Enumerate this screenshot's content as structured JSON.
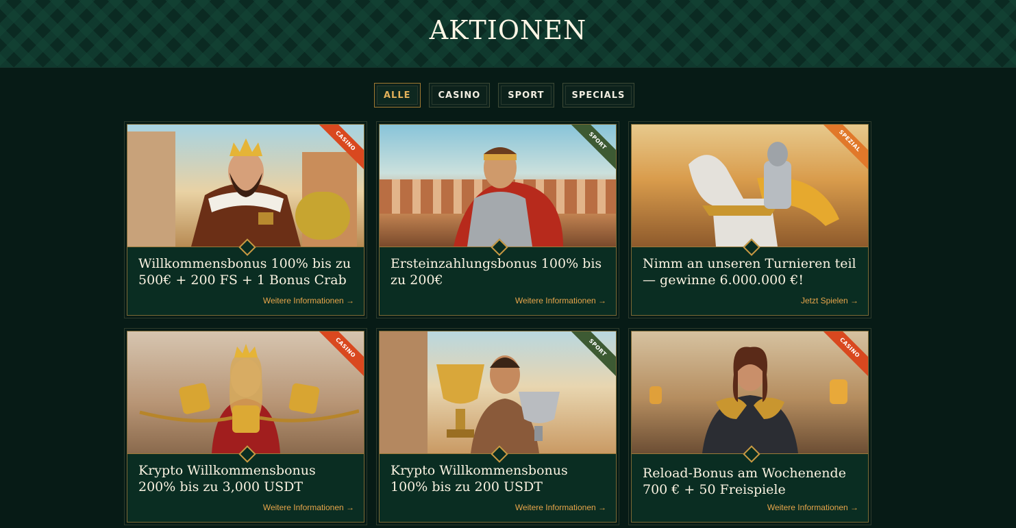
{
  "page": {
    "title": "AKTIONEN"
  },
  "filters": [
    {
      "label": "ALLE",
      "active": true
    },
    {
      "label": "CASINO",
      "active": false
    },
    {
      "label": "SPORT",
      "active": false
    },
    {
      "label": "SPECIALS",
      "active": false
    }
  ],
  "cards": [
    {
      "badge": "CASINO",
      "title": "Willkommensbonus 100% bis zu 500€ + 200 FS + 1 Bonus Crab",
      "link": "Weitere Informationen →",
      "badge_color": "#d9481f"
    },
    {
      "badge": "SPORT",
      "title": "Ersteinzahlungsbonus 100% bis zu 200€",
      "link": "Weitere Informationen →",
      "badge_color": "#3d5a33"
    },
    {
      "badge": "SPEZIAL",
      "title": "Nimm an unseren Turnieren teil — gewinne 6.000.000 €!",
      "link": "Jetzt Spielen →",
      "badge_color": "#e1782a"
    },
    {
      "badge": "CASINO",
      "title": "Krypto Willkommensbonus 200% bis zu 3,000 USDT",
      "link": "Weitere Informationen →",
      "badge_color": "#d9481f"
    },
    {
      "badge": "SPORT",
      "title": "Krypto Willkommensbonus 100% bis zu 200 USDT",
      "link": "Weitere Informationen →",
      "badge_color": "#3d5a33"
    },
    {
      "badge": "CASINO",
      "title": "Reload-Bonus am Wochenende 700 € + 50 Freispiele",
      "link": "Weitere Informationen →",
      "badge_color": "#d9481f"
    }
  ],
  "colors": {
    "background": "#071b16",
    "card": "#0a2d22",
    "accent": "#e7a54b",
    "border": "#9c7b39"
  }
}
